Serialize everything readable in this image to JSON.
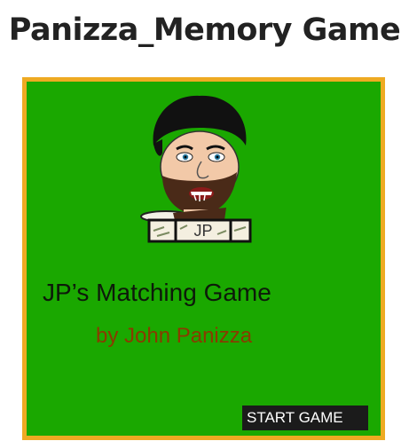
{
  "page": {
    "title": "Panizza_Memory Game"
  },
  "game": {
    "heading": "JP’s Matching Game",
    "author": "by John Panizza",
    "start_button": "START GAME",
    "avatar_tile_label": "JP",
    "colors": {
      "board": "#1aa800",
      "frame": "#eeaa22",
      "heading": "#0d1a0a",
      "author": "#8a3a00",
      "button_bg": "#1b1b1b",
      "button_text": "#ffffff"
    }
  }
}
